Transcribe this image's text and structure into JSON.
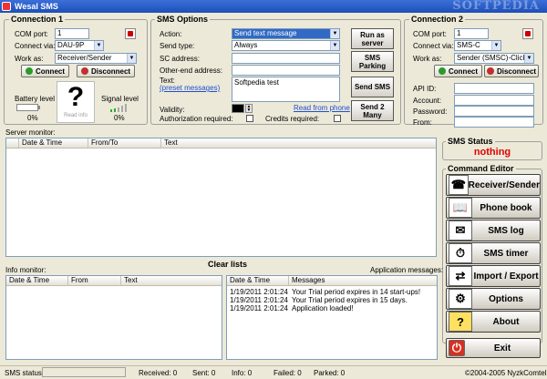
{
  "window": {
    "title": "Wesal SMS",
    "watermark": "SOFTPEDIA"
  },
  "connection1": {
    "title": "Connection 1",
    "com_port_label": "COM port:",
    "com_port_value": "1",
    "connect_via_label": "Connect via:",
    "connect_via_value": "DAU-9P",
    "work_as_label": "Work as:",
    "work_as_value": "Receiver/Sender",
    "connect_label": "Connect",
    "disconnect_label": "Disconnect",
    "battery_label": "Battery level",
    "battery_value": "0%",
    "signal_label": "Signal level",
    "signal_value": "0%",
    "read_info_label": "Read info",
    "phone_glyph": "?"
  },
  "sms_options": {
    "title": "SMS Options",
    "action_label": "Action:",
    "action_value": "Send text message",
    "send_type_label": "Send type:",
    "send_type_value": "Always",
    "sc_address_label": "SC address:",
    "sc_address_value": "",
    "other_end_label": "Other-end address:",
    "other_end_value": "",
    "text_label": "Text:",
    "preset_link": "(preset messages)",
    "text_value": "Softpedia test",
    "validity_label": "Validity:",
    "read_from_phone_link": "Read from phone",
    "auth_label": "Authorization required:",
    "credits_label": "Credits required:",
    "run_as_server": "Run as server",
    "sms_parking": "SMS Parking",
    "send_sms": "Send SMS",
    "send_2_many": "Send 2 Many"
  },
  "connection2": {
    "title": "Connection 2",
    "com_port_label": "COM port:",
    "com_port_value": "1",
    "connect_via_label": "Connect via:",
    "connect_via_value": "SMS-C",
    "work_as_label": "Work as:",
    "work_as_value": "Sender (SMSC)-Clickate",
    "connect_label": "Connect",
    "disconnect_label": "Disconnect",
    "api_id_label": "API ID:",
    "account_label": "Account:",
    "password_label": "Password:",
    "from_label": "From:"
  },
  "server_monitor": {
    "title": "Server monitor:",
    "columns": [
      "",
      "Date & Time",
      "From/To",
      "Text"
    ]
  },
  "sms_status": {
    "title": "SMS Status",
    "value": "nothing",
    "value_color": "#e00000"
  },
  "command_editor": {
    "title": "Command Editor",
    "buttons": [
      "Receiver/Sender",
      "Phone book",
      "SMS log",
      "SMS timer",
      "Import / Export",
      "Options",
      "About",
      "Exit"
    ]
  },
  "clear_lists": "Clear lists",
  "info_monitor": {
    "title": "Info monitor:",
    "columns": [
      "Date & Time",
      "From",
      "Text"
    ]
  },
  "app_messages": {
    "title": "Application messages:",
    "columns": [
      "Date & Time",
      "Messages"
    ],
    "rows": [
      {
        "time": "1/19/2011 2:01:24 ...",
        "message": "Your Trial period expires in 14 start-ups!"
      },
      {
        "time": "1/19/2011 2:01:24 ...",
        "message": "Your Trial period expires in 15 days."
      },
      {
        "time": "1/19/2011 2:01:24 ...",
        "message": "Application loaded!"
      }
    ]
  },
  "statusbar": {
    "sms_status_label": "SMS status:",
    "received": "Received: 0",
    "sent": "Sent: 0",
    "info": "Info: 0",
    "failed": "Failed: 0",
    "parked": "Parked: 0",
    "copyright": "©2004-2005 NyzkComtel"
  }
}
